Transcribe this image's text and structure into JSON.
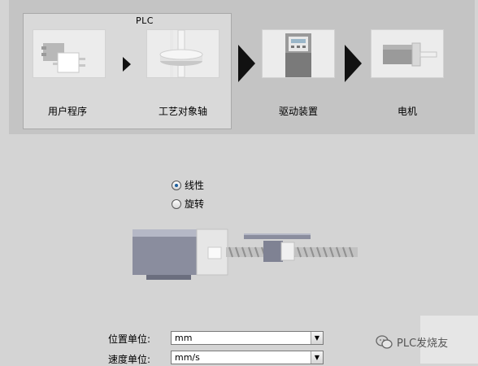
{
  "flow": {
    "plc_label": "PLC",
    "steps": [
      {
        "label": "用户程序",
        "icon": "user-program-icon"
      },
      {
        "label": "工艺对象轴",
        "icon": "axis-object-icon"
      },
      {
        "label": "驱动装置",
        "icon": "drive-device-icon"
      },
      {
        "label": "电机",
        "icon": "motor-icon"
      }
    ]
  },
  "motion_type": {
    "options": [
      {
        "label": "线性",
        "selected": true
      },
      {
        "label": "旋转",
        "selected": false
      }
    ]
  },
  "units": {
    "position_label": "位置单位:",
    "position_value": "mm",
    "velocity_label": "速度单位:",
    "velocity_value": "mm/s"
  },
  "watermark": {
    "text": "PLC发烧友"
  },
  "colors": {
    "accent": "#1c5f9e",
    "panel": "#c4c4c4",
    "background": "#d4d4d4"
  }
}
